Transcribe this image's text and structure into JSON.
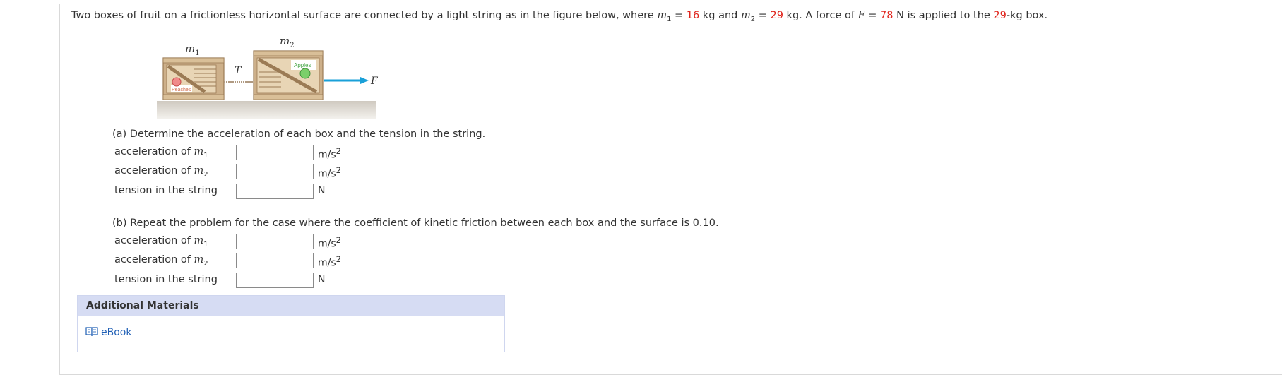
{
  "problem": {
    "text1": "Two boxes of fruit on a frictionless horizontal surface are connected by a light string as in the figure below, where ",
    "m1_sym": "m",
    "m1_sub": "1",
    "eq": " = ",
    "m1_val": "16",
    "kg_and": " kg  and ",
    "m2_sym": "m",
    "m2_sub": "2",
    "m2_val": "29",
    "kg_force": " kg.  A force of ",
    "F_sym": "F",
    "F_val": "78",
    "N_applied": " N  is applied to the ",
    "box_val": "29",
    "box_text": "-kg box."
  },
  "figure": {
    "m1_label": "m",
    "m1_label_sub": "1",
    "m2_label": "m",
    "m2_label_sub": "2",
    "T_label": "T",
    "F_label": "F",
    "box1_text": "Peaches",
    "box2_text": "Apples"
  },
  "part_a": {
    "title": "(a) Determine the acceleration of each box and the tension in the string.",
    "rows": [
      {
        "label_pre": "acceleration of ",
        "sym": "m",
        "sub": "1",
        "unit": "m/s",
        "unit_sup": "2",
        "value": ""
      },
      {
        "label_pre": "acceleration of ",
        "sym": "m",
        "sub": "2",
        "unit": "m/s",
        "unit_sup": "2",
        "value": ""
      },
      {
        "label_pre": "tension in the string",
        "sym": "",
        "sub": "",
        "unit": "N",
        "unit_sup": "",
        "value": ""
      }
    ]
  },
  "part_b": {
    "title": "(b) Repeat the problem for the case where the coefficient of kinetic friction between each box and the surface is 0.10.",
    "rows": [
      {
        "label_pre": "acceleration of ",
        "sym": "m",
        "sub": "1",
        "unit": "m/s",
        "unit_sup": "2",
        "value": ""
      },
      {
        "label_pre": "acceleration of ",
        "sym": "m",
        "sub": "2",
        "unit": "m/s",
        "unit_sup": "2",
        "value": ""
      },
      {
        "label_pre": "tension in the string",
        "sym": "",
        "sub": "",
        "unit": "N",
        "unit_sup": "",
        "value": ""
      }
    ]
  },
  "additional": {
    "header": "Additional Materials",
    "ebook_label": "eBook",
    "ebook_icon": "book-icon"
  },
  "colors": {
    "given_value": "#e0241c",
    "link": "#1f5fb5",
    "header_bg": "#d6dcf3",
    "arrow": "#1aa0d8"
  }
}
